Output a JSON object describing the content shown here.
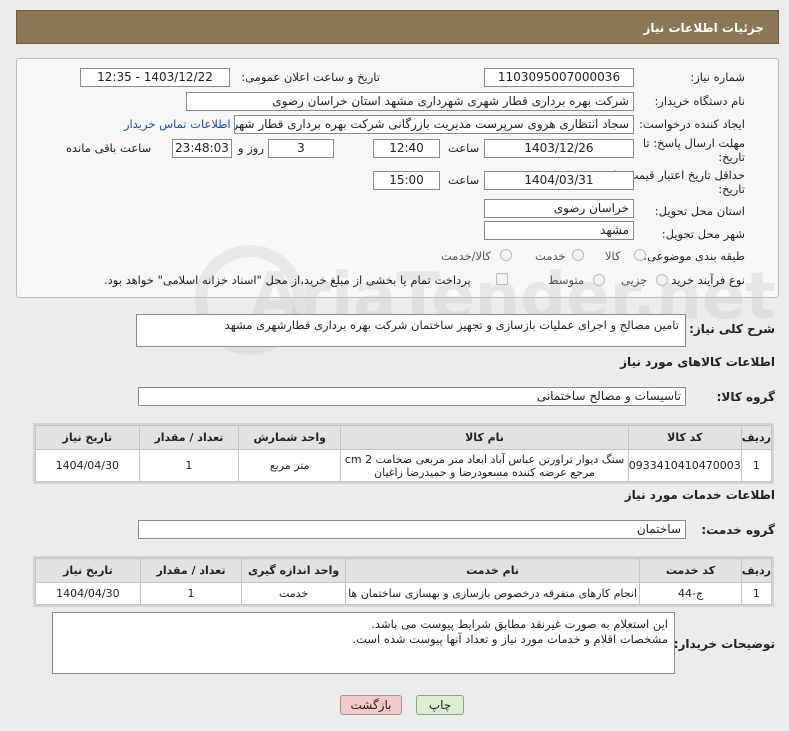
{
  "header": {
    "title": "جزئیات اطلاعات نیاز"
  },
  "form": {
    "need_number_label": "شماره نیاز:",
    "need_number": "1103095007000036",
    "announce_label": "تاریخ و ساعت اعلان عمومی:",
    "announce_value": "1403/12/22 - 12:35",
    "buyer_label": "نام دستگاه خریدار:",
    "buyer_value": "شرکت بهره برداری قطار شهری شهرداری مشهد استان خراسان رضوی",
    "creator_label": "ایجاد کننده درخواست:",
    "creator_value": "سجاد انتظاری هروی سرپرست مدیریت بازرگانی شرکت بهره برداری قطار شهری",
    "contact_link": "اطلاعات تماس خریدار",
    "deadline_label_1": "مهلت ارسال پاسخ: تا",
    "deadline_label_2": "تاریخ:",
    "deadline_date": "1403/12/26",
    "time_label": "ساعت",
    "deadline_time": "12:40",
    "days_value": "3",
    "days_label": "روز و",
    "remaining_time": "23:48:03",
    "remaining_label": "ساعت باقی مانده",
    "validity_label_1": "حداقل تاریخ اعتبار قیمت: تا",
    "validity_label_2": "تاریخ:",
    "validity_date": "1404/03/31",
    "validity_time": "15:00",
    "province_label": "استان محل تحویل:",
    "province_value": "خراسان رضوی",
    "city_label": "شهر محل تحویل:",
    "city_value": "مشهد",
    "category_label": "طبقه بندی موضوعی:",
    "category_options": [
      "کالا",
      "خدمت",
      "کالا/خدمت"
    ],
    "process_label": "نوع فرآیند خرید :",
    "process_options": [
      "جزیی",
      "متوسط"
    ],
    "payment_note": "پرداخت تمام یا بخشی از مبلغ خرید،از محل \"اسناد خزانه اسلامی\" خواهد بود."
  },
  "description": {
    "label": "شرح کلی نیاز:",
    "value": "تامین مصالح و اجرای عملیات بازسازی و تجهیز ساختمان شرکت بهره برداری قطارشهری مشهد"
  },
  "goods": {
    "title": "اطلاعات کالاهای مورد نیاز",
    "group_label": "گروه کالا:",
    "group_value": "تاسیسات و مصالح ساختمانی",
    "columns": [
      "ردیف",
      "کد کالا",
      "نام کالا",
      "واحد شمارش",
      "تعداد / مقدار",
      "تاریخ نیاز"
    ],
    "rows": [
      {
        "index": "1",
        "code": "0933410410470003",
        "name_line1": "سنگ دیوار تراورتن عباس آباد ابعاد متر مربعی ضخامت 2 cm",
        "name_line2": "مرجع عرضه کننده مسعودرضا و حمیدرضا زاغیان",
        "unit": "متر مربع",
        "qty": "1",
        "date": "1404/04/30"
      }
    ]
  },
  "services": {
    "title": "اطلاعات خدمات مورد نیاز",
    "group_label": "گروه خدمت:",
    "group_value": "ساختمان",
    "columns": [
      "ردیف",
      "کد خدمت",
      "نام خدمت",
      "واحد اندازه گیری",
      "تعداد / مقدار",
      "تاریخ نیاز"
    ],
    "rows": [
      {
        "index": "1",
        "code": "ج-44",
        "name": "انجام کارهای متفرقه درخصوص بازسازی و بهسازی ساختمان ها",
        "unit": "خدمت",
        "qty": "1",
        "date": "1404/04/30"
      }
    ]
  },
  "buyer_notes": {
    "label": "توضیحات خریدار:",
    "line1": "این استعلام به صورت غیرنقد مطابق شرایط پیوست می باشد.",
    "line2": "مشخصات اقلام و خدمات مورد نیاز و تعداد آنها پیوست شده است."
  },
  "buttons": {
    "print": "چاپ",
    "back": "بازگشت"
  },
  "watermark": "AriaTender.net",
  "colors": {
    "header_bg": "#8b7655",
    "link": "#1a4fb0",
    "back_btn": "#f3c9c9",
    "print_btn": "#d9f0d3"
  }
}
